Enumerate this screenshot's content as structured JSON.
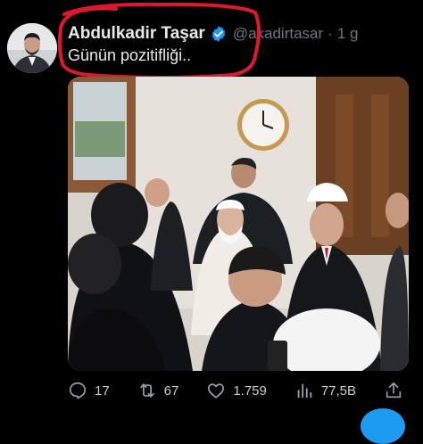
{
  "tweet": {
    "author_name": "Abdulkadir Taşar",
    "handle": "@akadirtasar",
    "separator": "·",
    "time": "1 g",
    "text": "Günün pozitifliği..",
    "verified": true
  },
  "actions": {
    "replies": "17",
    "retweets": "67",
    "likes": "1.759",
    "views": "77,5B"
  },
  "icons": {
    "reply": "reply-icon",
    "retweet": "retweet-icon",
    "like": "heart-icon",
    "views": "views-chart-icon",
    "share": "share-icon",
    "verified": "verified-badge-icon"
  },
  "colors": {
    "background": "#000000",
    "text": "#e7e9ea",
    "muted": "#71767b",
    "verified": "#1d9bf0",
    "annotation": "#e0182f"
  }
}
